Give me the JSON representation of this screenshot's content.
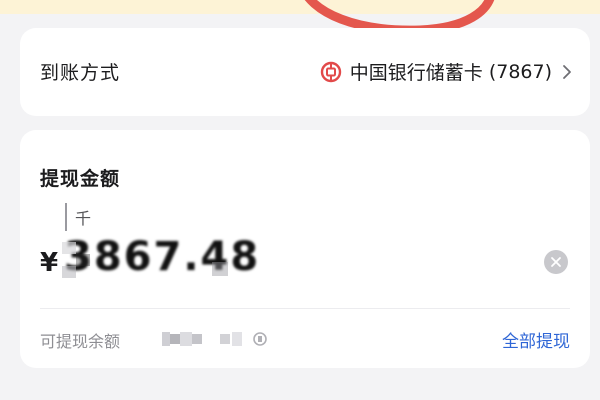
{
  "receiving_method": {
    "label": "到账方式",
    "bank_name": "中国银行储蓄卡",
    "card_suffix": "(7867)",
    "logo_color": "#e24a4a"
  },
  "withdraw": {
    "title": "提现金额",
    "unit_hint": "千",
    "currency_symbol": "¥",
    "amount": "3867.48",
    "available_label": "可提现余额",
    "withdraw_all_label": "全部提现"
  },
  "colors": {
    "accent": "#2f66d6",
    "annotation": "#e4574d",
    "notice_bg": "#fdf3d6"
  }
}
